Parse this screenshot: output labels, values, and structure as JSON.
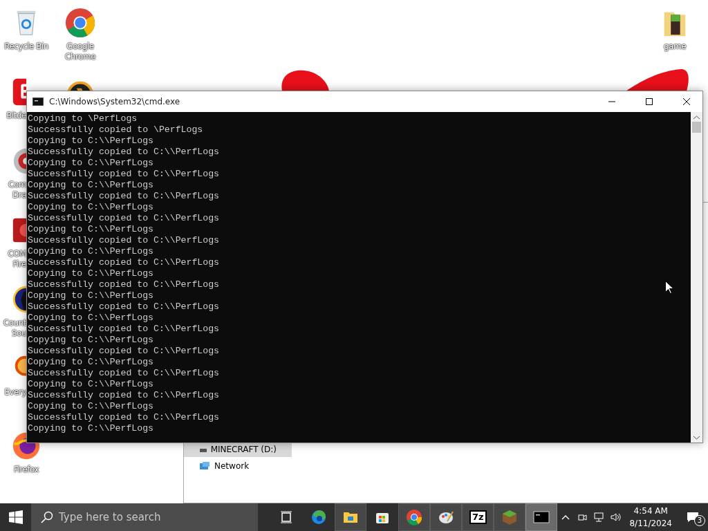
{
  "desktop": {
    "columns": [
      [
        {
          "kind": "recycle",
          "lines": [
            "Recycle Bin"
          ],
          "clipped": false
        },
        {
          "kind": "bitdefender",
          "lines": [
            "Bitde"
          ],
          "clipped": true
        },
        {
          "kind": "disc",
          "lines": [
            "Com",
            "Dra"
          ],
          "clipped": true
        },
        {
          "kind": "firewall",
          "lines": [
            "COM",
            "Fire"
          ],
          "clipped": true
        },
        {
          "kind": "soldier",
          "lines": [
            "Count",
            "Sou"
          ],
          "clipped": true
        },
        {
          "kind": "search",
          "lines": [
            "Every"
          ],
          "clipped": true
        },
        {
          "kind": "firefox",
          "lines": [
            "Firefox"
          ],
          "clipped": false
        }
      ],
      [
        {
          "kind": "chrome",
          "lines": [
            "Google",
            "Chrome"
          ],
          "clipped": false
        },
        {
          "kind": "lambda",
          "clipped": true
        }
      ]
    ],
    "right_icons": [
      {
        "kind": "folder",
        "lines": [
          "game"
        ],
        "clipped": false
      }
    ]
  },
  "explorer": {
    "nav_items": [
      {
        "kind": "drive",
        "label": "MINECRAFT (D:)",
        "selected": true
      },
      {
        "kind": "network",
        "label": "Network",
        "selected": false
      }
    ]
  },
  "console": {
    "title": "C:\\Windows\\System32\\cmd.exe",
    "lines": [
      "Copying to \\PerfLogs",
      "Successfully copied to \\PerfLogs",
      "Copying to C:\\\\PerfLogs",
      "Successfully copied to C:\\\\PerfLogs",
      "Copying to C:\\\\PerfLogs",
      "Successfully copied to C:\\\\PerfLogs",
      "Copying to C:\\\\PerfLogs",
      "Successfully copied to C:\\\\PerfLogs",
      "Copying to C:\\\\PerfLogs",
      "Successfully copied to C:\\\\PerfLogs",
      "Copying to C:\\\\PerfLogs",
      "Successfully copied to C:\\\\PerfLogs",
      "Copying to C:\\\\PerfLogs",
      "Successfully copied to C:\\\\PerfLogs",
      "Copying to C:\\\\PerfLogs",
      "Successfully copied to C:\\\\PerfLogs",
      "Copying to C:\\\\PerfLogs",
      "Successfully copied to C:\\\\PerfLogs",
      "Copying to C:\\\\PerfLogs",
      "Successfully copied to C:\\\\PerfLogs",
      "Copying to C:\\\\PerfLogs",
      "Successfully copied to C:\\\\PerfLogs",
      "Copying to C:\\\\PerfLogs",
      "Successfully copied to C:\\\\PerfLogs",
      "Copying to C:\\\\PerfLogs",
      "Successfully copied to C:\\\\PerfLogs",
      "Copying to C:\\\\PerfLogs",
      "Successfully copied to C:\\\\PerfLogs",
      "Copying to C:\\\\PerfLogs"
    ]
  },
  "taskbar": {
    "search": {
      "placeholder": "Type here to search"
    },
    "apps": [
      {
        "kind": "taskview",
        "open": false,
        "selected": false
      },
      {
        "kind": "edge",
        "open": false,
        "selected": false
      },
      {
        "kind": "explorer",
        "open": true,
        "selected": false
      },
      {
        "kind": "store",
        "open": false,
        "selected": false
      },
      {
        "kind": "chrome",
        "open": true,
        "selected": false
      },
      {
        "kind": "paint",
        "open": true,
        "selected": false
      },
      {
        "kind": "sevenzip",
        "open": true,
        "selected": false,
        "label": "7z"
      },
      {
        "kind": "minecraft",
        "open": true,
        "selected": false
      },
      {
        "kind": "cmd",
        "open": true,
        "selected": true
      }
    ],
    "time": "4:54 AM",
    "date": "8/11/2024",
    "notifications": "3"
  }
}
